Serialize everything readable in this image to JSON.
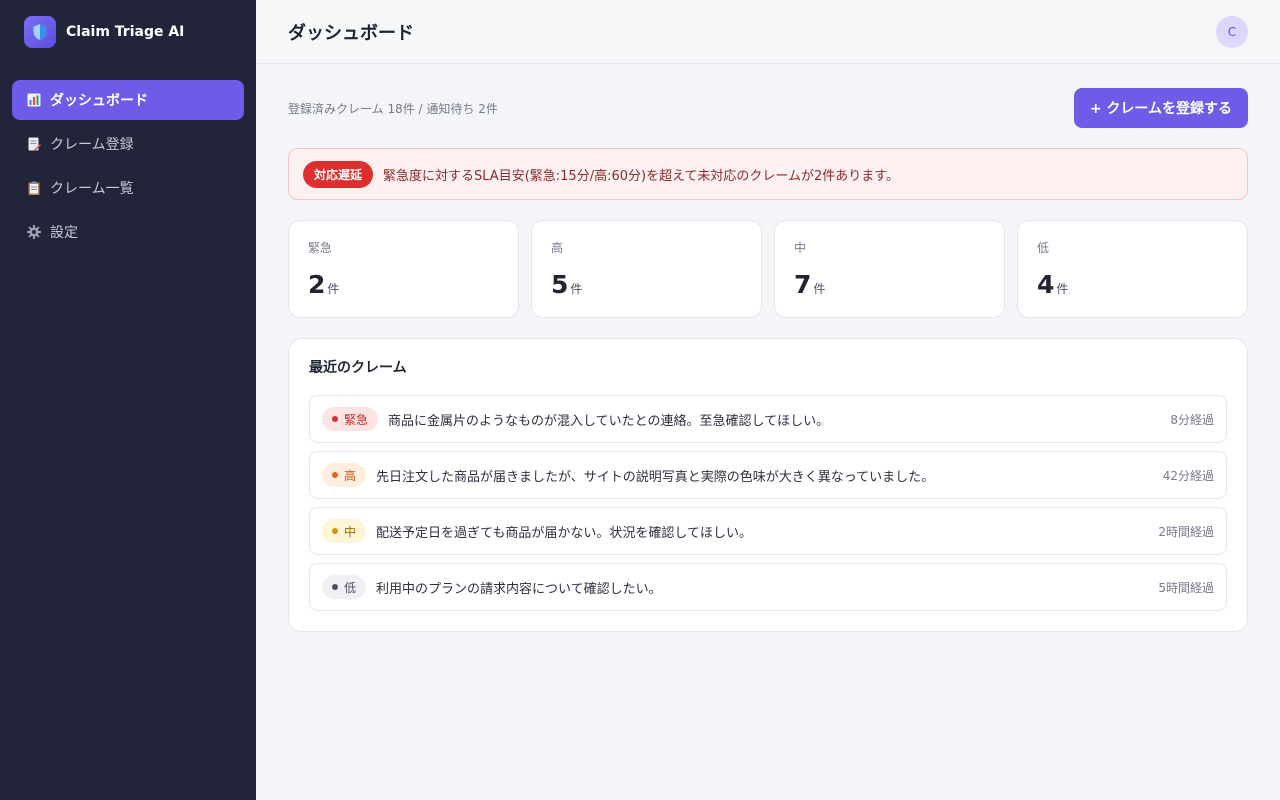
{
  "app": {
    "name": "Claim Triage AI",
    "logo_icon": "shield-icon"
  },
  "sidebar": {
    "items": [
      {
        "label": "ダッシュボード",
        "icon": "bar-chart-icon",
        "active": true
      },
      {
        "label": "クレーム登録",
        "icon": "document-edit-icon",
        "active": false
      },
      {
        "label": "クレーム一覧",
        "icon": "clipboard-icon",
        "active": false
      },
      {
        "label": "設定",
        "icon": "gear-icon",
        "active": false
      }
    ]
  },
  "header": {
    "title": "ダッシュボード",
    "avatar_initial": "C"
  },
  "summary": {
    "text": "登録済みクレーム 18件 / 通知待ち 2件",
    "register_button": "+ クレームを登録する"
  },
  "alert": {
    "badge": "対応遅延",
    "message": "緊急度に対するSLA目安(緊急:15分/高:60分)を超えて未対応のクレームが2件あります。"
  },
  "stats": [
    {
      "label": "緊急",
      "value": "2",
      "unit": "件"
    },
    {
      "label": "高",
      "value": "5",
      "unit": "件"
    },
    {
      "label": "中",
      "value": "7",
      "unit": "件"
    },
    {
      "label": "低",
      "value": "4",
      "unit": "件"
    }
  ],
  "recent": {
    "title": "最近のクレーム",
    "claims": [
      {
        "priority": "緊急",
        "text": "商品に金属片のようなものが混入していたとの連絡。至急確認してほしい。",
        "time": "8分経過",
        "badge_bg": "#fde4e4",
        "badge_fg": "#c62828",
        "dot": "#d32f2f"
      },
      {
        "priority": "高",
        "text": "先日注文した商品が届きましたが、サイトの説明写真と実際の色味が大きく異なっていました。",
        "time": "42分経過",
        "badge_bg": "#fdeee0",
        "badge_fg": "#c2560c",
        "dot": "#e0661a"
      },
      {
        "priority": "中",
        "text": "配送予定日を過ぎても商品が届かない。状況を確認してほしい。",
        "time": "2時間経過",
        "badge_bg": "#fdf5d6",
        "badge_fg": "#a06a00",
        "dot": "#c99a06"
      },
      {
        "priority": "低",
        "text": "利用中のプランの請求内容について確認したい。",
        "time": "5時間経過",
        "badge_bg": "#eef0f4",
        "badge_fg": "#4a5060",
        "dot": "#4a5060"
      }
    ]
  }
}
